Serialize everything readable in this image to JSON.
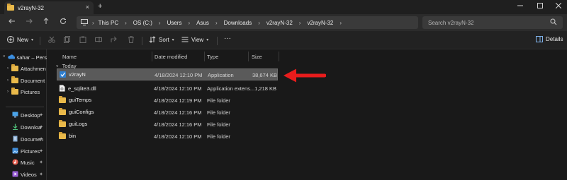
{
  "window": {
    "tab_title": "v2rayN-32",
    "new_tab": "+",
    "tab_close": "×"
  },
  "address": {
    "crumbs": [
      "This PC",
      "OS (C:)",
      "Users",
      "Asus",
      "Downloads",
      "v2rayN-32",
      "v2rayN-32"
    ],
    "search_placeholder": "Search v2rayN-32"
  },
  "toolbar": {
    "new_label": "New",
    "sort_label": "Sort",
    "view_label": "View",
    "more_label": "···",
    "details_label": "Details"
  },
  "nav": {
    "top_items": [
      {
        "label": "sahar – Perso",
        "icon": "onedrive-icon"
      },
      {
        "label": "Attachmen",
        "icon": "folder-icon"
      },
      {
        "label": "Document",
        "icon": "folder-icon"
      },
      {
        "label": "Pictures",
        "icon": "folder-icon"
      }
    ],
    "quick_items": [
      {
        "label": "Desktop",
        "icon": "desktop-icon"
      },
      {
        "label": "Downloa",
        "icon": "download-icon"
      },
      {
        "label": "Documen",
        "icon": "document-icon"
      },
      {
        "label": "Pictures",
        "icon": "pictures-icon"
      },
      {
        "label": "Music",
        "icon": "music-icon"
      },
      {
        "label": "Videos",
        "icon": "videos-icon"
      }
    ]
  },
  "columns": {
    "name": "Name",
    "date": "Date modified",
    "type": "Type",
    "size": "Size"
  },
  "group_label": "Today",
  "files": [
    {
      "name": "v2rayN",
      "date": "4/18/2024 12:10 PM",
      "type": "Application",
      "size": "38,674 KB",
      "icon": "app-icon",
      "selected": true
    },
    {
      "name": "e_sqlite3.dll",
      "date": "4/18/2024 12:10 PM",
      "type": "Application extens...",
      "size": "1,218 KB",
      "icon": "dll-file-icon",
      "selected": false
    },
    {
      "name": "guiTemps",
      "date": "4/18/2024 12:19 PM",
      "type": "File folder",
      "size": "",
      "icon": "folder-icon",
      "selected": false
    },
    {
      "name": "guiConfigs",
      "date": "4/18/2024 12:16 PM",
      "type": "File folder",
      "size": "",
      "icon": "folder-icon",
      "selected": false
    },
    {
      "name": "guiLogs",
      "date": "4/18/2024 12:16 PM",
      "type": "File folder",
      "size": "",
      "icon": "folder-icon",
      "selected": false
    },
    {
      "name": "bin",
      "date": "4/18/2024 12:10 PM",
      "type": "File folder",
      "size": "",
      "icon": "folder-icon",
      "selected": false
    }
  ],
  "colors": {
    "arrow": "#e81c1c",
    "folder": "#e9b94a",
    "selection": "#5a5a5a"
  }
}
